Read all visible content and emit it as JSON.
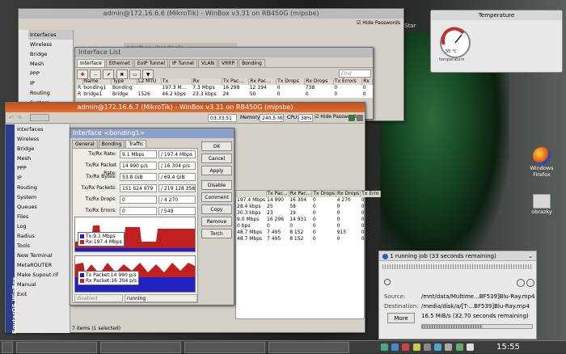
{
  "winbox_back": {
    "title": "admin@172.16.6.6 (MikroTik) - WinBox v3.31 on RB450G (mipsbe)",
    "hide_passwords": "Hide Passwords",
    "sidebar": [
      "Interfaces",
      "Wireless",
      "Bridge",
      "Mesh",
      "PPP",
      "IP",
      "Routing",
      "System"
    ]
  },
  "iface_back": {
    "title": "Interface <bonding1>"
  },
  "iface_list": {
    "title": "Interface List",
    "tabs": [
      "Interface",
      "Ethernet",
      "EoIP Tunnel",
      "IP Tunnel",
      "VLAN",
      "VRRP",
      "Bonding"
    ],
    "find": "Find",
    "columns": [
      "Name",
      "Type",
      "L2 MTU",
      "Tx",
      "Rx",
      "Tx Pac...",
      "Rx Pac...",
      "Tx Drops",
      "Rx Drops",
      "Tx Errors",
      "Rx"
    ],
    "rows": [
      {
        "flag": "R",
        "name": "bonding1",
        "type": "Bonding",
        "mtu": "",
        "tx": "197.3 M...",
        "rx": "7.3 Mbps",
        "txp": "16 298",
        "rxp": "12 194",
        "txd": "0",
        "rxd": "738",
        "txe": "0",
        "rx2": "0"
      },
      {
        "flag": "R",
        "name": "bridge1",
        "type": "Bridge",
        "mtu": "1526",
        "tx": "46.2 kbps",
        "rx": "23.3 kbps",
        "txp": "24",
        "rxp": "50",
        "txd": "0",
        "rxd": "0",
        "txe": "0",
        "rx2": "0"
      }
    ]
  },
  "winbox_front": {
    "title": "admin@172.16.6.7 (MikroTik) - WinBox v3.31 on RB450G (mipsbe)",
    "time": "03:33:51",
    "memory_label": "Memory:",
    "memory": "240.5 MiB",
    "cpu_label": "CPU:",
    "cpu": "38%",
    "hide_passwords": "Hide Passwords",
    "sidebar": [
      "Interfaces",
      "Wireless",
      "Bridge",
      "Mesh",
      "PPP",
      "IP",
      "Routing",
      "System",
      "Queues",
      "Files",
      "Log",
      "Radius",
      "Tools",
      "New Terminal",
      "MetaROUTER",
      "Make Supout.rif",
      "Manual",
      "Exit"
    ],
    "brand": "RouterOS WinBox",
    "status": "7 items (1 selected)"
  },
  "iface_dialog": {
    "title": "Interface <bonding1>",
    "tabs": [
      "General",
      "Bonding",
      "Traffic"
    ],
    "rows": [
      {
        "label": "Tx/Rx Rate:",
        "a": "9.1 Mbps",
        "b": "197.4 Mbps"
      },
      {
        "label": "Tx/Rx Packet Rate:",
        "a": "14 990 p/s",
        "b": "16 304 p/s"
      },
      {
        "label": "Tx/Rx Bytes:",
        "a": "53.8 GiB",
        "b": "69.4 GiB"
      },
      {
        "label": "Tx/Rx Packets:",
        "a": "151 624 979",
        "b": "219 128 358"
      },
      {
        "label": "Tx/Rx Drops:",
        "a": "0",
        "b": "4 270"
      },
      {
        "label": "Tx/Rx Errors:",
        "a": "0",
        "b": "549"
      }
    ],
    "legend1": [
      {
        "name": "Tx:",
        "value": "9.1 Mbps",
        "color": "#2020c0"
      },
      {
        "name": "Rx:",
        "value": "197.4 Mbps",
        "color": "#c02020"
      }
    ],
    "legend2": [
      {
        "name": "Tx Packet:",
        "value": "14 990 p/s",
        "color": "#2020c0"
      },
      {
        "name": "Rx Packet:",
        "value": "16 304 p/s",
        "color": "#c02020"
      }
    ],
    "buttons": [
      "OK",
      "Cancel",
      "Apply",
      "Disable",
      "Comment",
      "Copy",
      "Remove",
      "Torch"
    ],
    "state_left": "disabled",
    "state_right": "running"
  },
  "front_table": {
    "columns": [
      "",
      "Tx Pac...",
      "Rx Pac...",
      "Tx Drops",
      "Rx Drops",
      "Tx Erro"
    ],
    "rows": [
      [
        "197.4 Mbps",
        "14 990",
        "16 304",
        "0",
        "4 270",
        "0"
      ],
      [
        "28.4 kbps",
        "25",
        "58",
        "0",
        "0",
        "0"
      ],
      [
        "30.3 kbps",
        "23",
        "19",
        "0",
        "0",
        "0"
      ],
      [
        "9.0 Mbps",
        "16 296",
        "14 931",
        "0",
        "0",
        "0"
      ],
      [
        "0 bps",
        "0",
        "0",
        "0",
        "0",
        "0"
      ],
      [
        "48.7 Mbps",
        "7 495",
        "8 152",
        "0",
        "915",
        "0"
      ],
      [
        "48.7 Mbps",
        "7 495",
        "8 152",
        "0",
        "0",
        "0"
      ]
    ]
  },
  "temperature": {
    "title": "Temperature",
    "value": "55 °C",
    "caption": "temperature"
  },
  "desktop_icons": [
    {
      "label": "Windows\nFirefox"
    },
    {
      "label": "obrazky"
    }
  ],
  "desktop_left": "Star",
  "copy_job": {
    "title": "1 running job (33 seconds remaining)",
    "source_label": "Source:",
    "source": "/mnt/data/Multime...BF539]Blu-Ray.mp4",
    "dest_label": "Destination:",
    "dest": "/media/disk/a/[T-...BF539]Blu-Ray.mp4",
    "rate": "16.5 MiB/s (32.70 seconds remaining)",
    "more": "More",
    "progress": 0.55
  },
  "taskbar": {
    "clock": "15:55"
  }
}
